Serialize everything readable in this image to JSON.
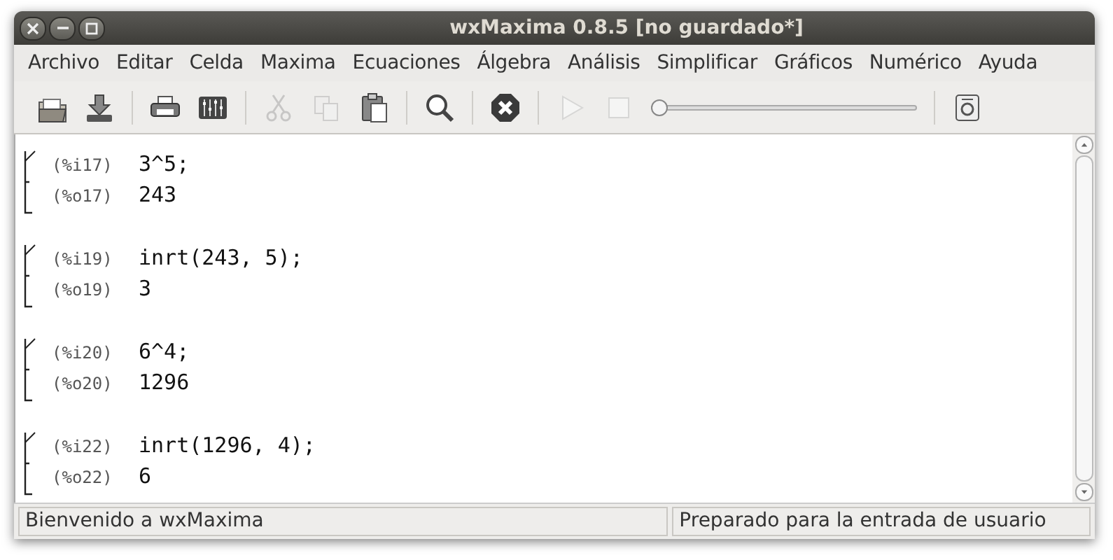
{
  "window": {
    "title": "wxMaxima 0.8.5 [no guardado*]"
  },
  "menu": [
    "Archivo",
    "Editar",
    "Celda",
    "Maxima",
    "Ecuaciones",
    "Álgebra",
    "Análisis",
    "Simplificar",
    "Gráficos",
    "Numérico",
    "Ayuda"
  ],
  "toolbar": [
    {
      "kind": "button",
      "disabled": false
    },
    {
      "kind": "button",
      "disabled": false
    },
    {
      "kind": "separator"
    },
    {
      "kind": "button",
      "disabled": false
    },
    {
      "kind": "button",
      "disabled": false
    },
    {
      "kind": "separator"
    },
    {
      "kind": "button",
      "disabled": true
    },
    {
      "kind": "button",
      "disabled": true
    },
    {
      "kind": "button",
      "disabled": false
    },
    {
      "kind": "separator"
    },
    {
      "kind": "button",
      "disabled": false
    },
    {
      "kind": "separator"
    },
    {
      "kind": "button",
      "disabled": false
    },
    {
      "kind": "separator"
    },
    {
      "kind": "button",
      "disabled": true
    },
    {
      "kind": "button",
      "disabled": true
    },
    {
      "kind": "slider",
      "level": 0
    },
    {
      "kind": "separator"
    },
    {
      "kind": "button",
      "disabled": false
    }
  ],
  "cells": [
    {
      "input_label": "(%i17)",
      "input": "3^5;",
      "output_label": "(%o17)",
      "output": "243"
    },
    {
      "input_label": "(%i19)",
      "input": "inrt(243, 5);",
      "output_label": "(%o19)",
      "output": "3"
    },
    {
      "input_label": "(%i20)",
      "input": "6^4;",
      "output_label": "(%o20)",
      "output": "1296"
    },
    {
      "input_label": "(%i22)",
      "input": "inrt(1296, 4);",
      "output_label": "(%o22)",
      "output": "6"
    }
  ],
  "status_bar": [
    "Bienvenido a wxMaxima",
    "Preparado para la entrada de usuario"
  ]
}
